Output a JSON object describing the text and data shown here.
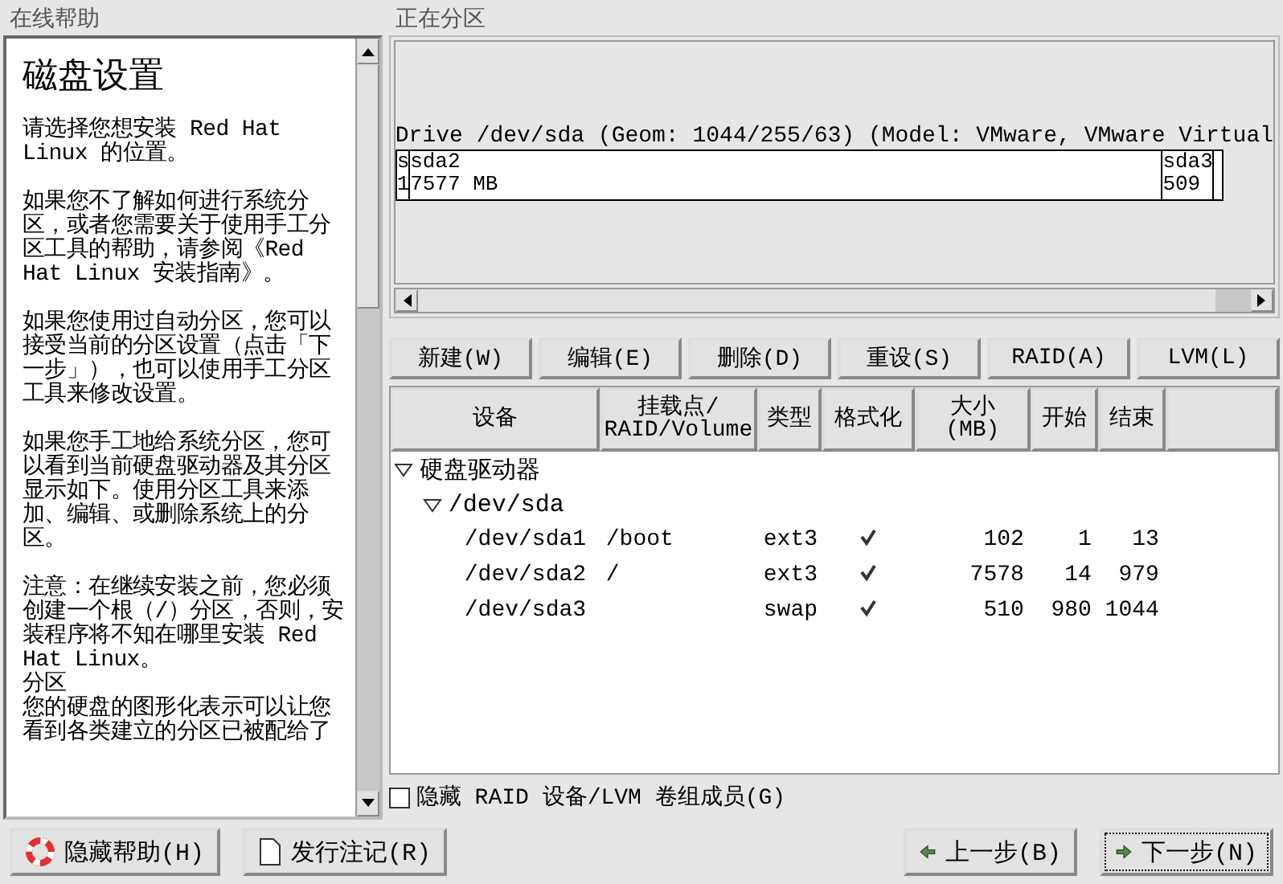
{
  "help": {
    "title": "在线帮助",
    "heading": "磁盘设置",
    "paragraphs": [
      "请选择您想安装 Red Hat Linux 的位置。",
      "如果您不了解如何进行系统分区，或者您需要关于使用手工分区工具的帮助，请参阅《Red Hat Linux 安装指南》。",
      "如果您使用过自动分区，您可以接受当前的分区设置（点击「下一步」），也可以使用手工分区工具来修改设置。",
      "如果您手工地给系统分区，您可以看到当前硬盘驱动器及其分区显示如下。使用分区工具来添加、编辑、或删除系统上的分区。",
      "注意：在继续安装之前，您必须创建一个根（/）分区，否则，安装程序将不知在哪里安装 Red Hat Linux。",
      "分区",
      "您的硬盘的图形化表示可以让您看到各类建立的分区已被配给了"
    ]
  },
  "partitioning": {
    "title": "正在分区",
    "drive_label": "Drive /dev/sda (Geom: 1044/255/63) (Model: VMware, VMware Virtual",
    "segments": [
      {
        "name": "s",
        "size": "1"
      },
      {
        "name": "sda2",
        "size": "7577 MB"
      },
      {
        "name": "sda3",
        "size": "509"
      }
    ],
    "actions": [
      "新建(W)",
      "编辑(E)",
      "删除(D)",
      "重设(S)",
      "RAID(A)",
      "LVM(L)"
    ],
    "columns": [
      "设备",
      "挂载点/\nRAID/Volume",
      "类型",
      "格式化",
      "大小\n(MB)",
      "开始",
      "结束"
    ],
    "tree": [
      {
        "label": "硬盘驱动器",
        "expanded": true,
        "children": [
          {
            "label": "/dev/sda",
            "expanded": true,
            "children": [
              {
                "device": "/dev/sda1",
                "mount": "/boot",
                "type": "ext3",
                "formatted": true,
                "size": "102",
                "start": "1",
                "end": "13"
              },
              {
                "device": "/dev/sda2",
                "mount": "/",
                "type": "ext3",
                "formatted": true,
                "size": "7578",
                "start": "14",
                "end": "979"
              },
              {
                "device": "/dev/sda3",
                "type": "swap",
                "formatted": true,
                "size": "510",
                "start": "980",
                "end": "1044"
              }
            ]
          }
        ]
      }
    ],
    "hide_members": {
      "label": "隐藏 RAID 设备/LVM 卷组成员(G)",
      "checked": false
    }
  },
  "footer": {
    "left_buttons": [
      "隐藏帮助(H)",
      "发行注记(R)"
    ],
    "back": "上一步(B)",
    "next": "下一步(N)"
  }
}
